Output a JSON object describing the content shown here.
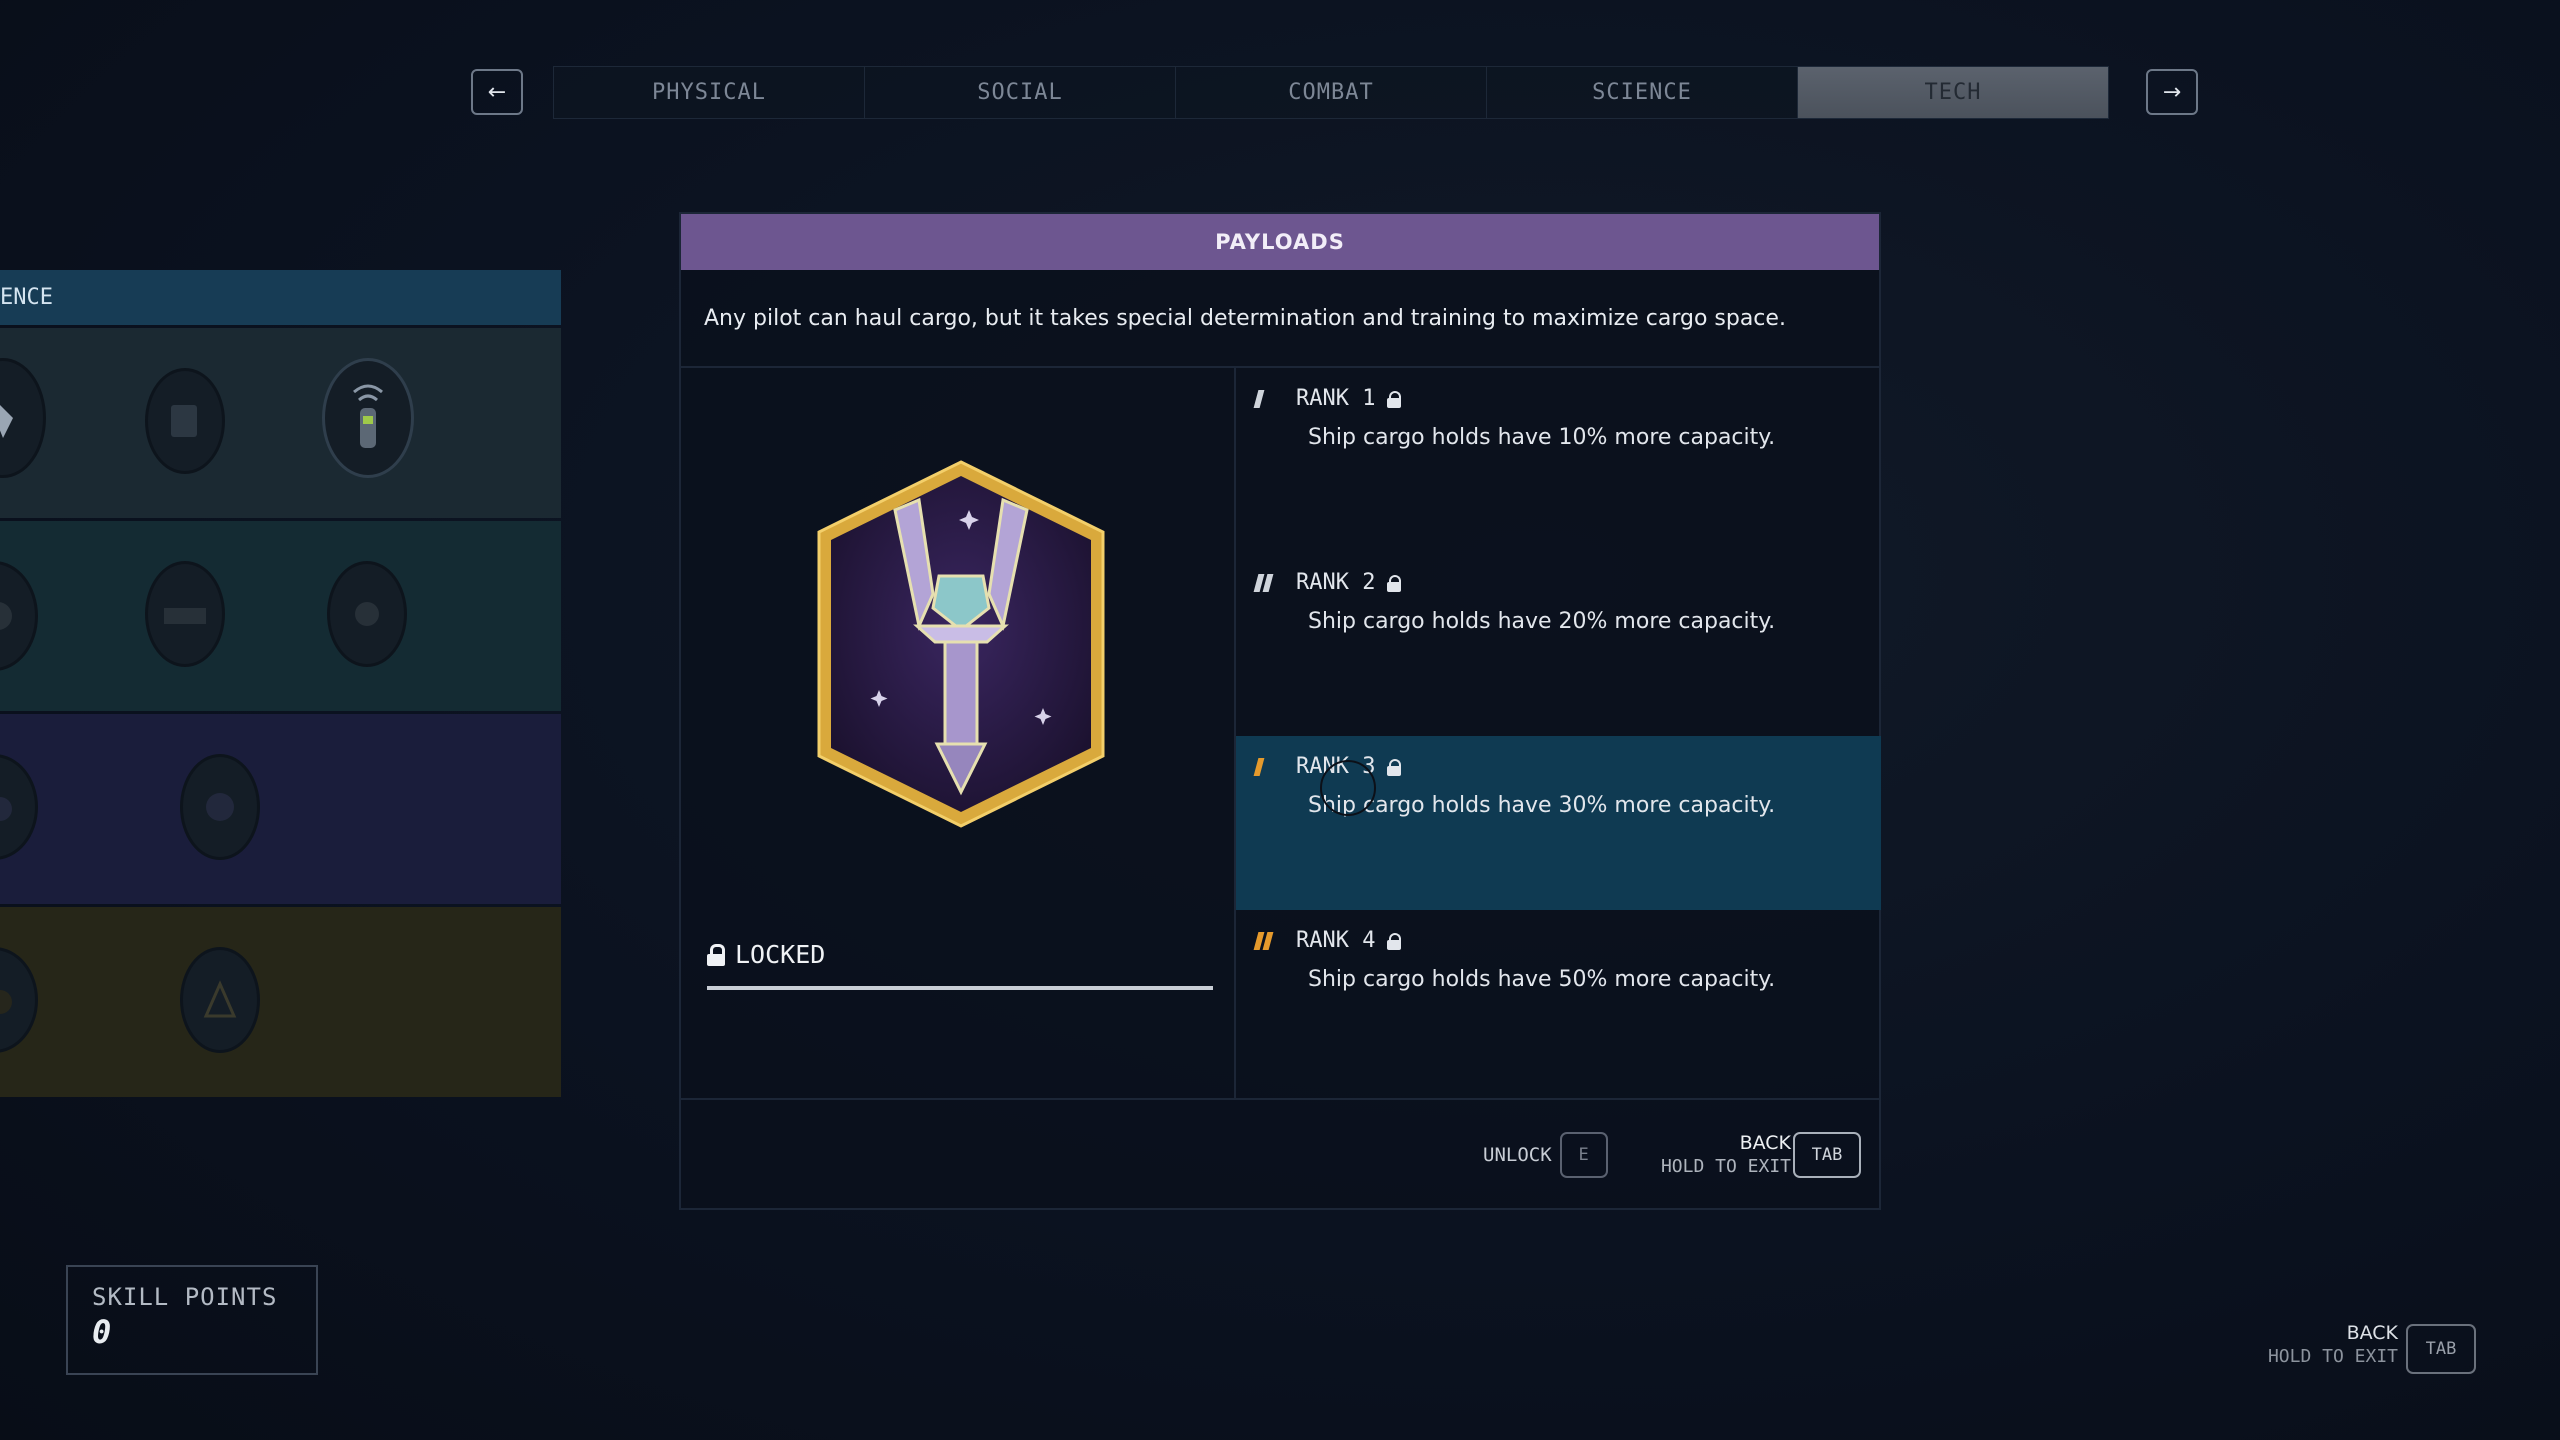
{
  "nav": {
    "prev_icon": "←",
    "next_icon": "→",
    "tabs": [
      {
        "label": "PHYSICAL",
        "active": false
      },
      {
        "label": "SOCIAL",
        "active": false
      },
      {
        "label": "COMBAT",
        "active": false
      },
      {
        "label": "SCIENCE",
        "active": false
      },
      {
        "label": "TECH",
        "active": true
      }
    ]
  },
  "tree": {
    "header": "ENCE"
  },
  "skill": {
    "title": "PAYLOADS",
    "description": "Any pilot can haul cargo, but it takes special determination and training to maximize cargo space.",
    "status": "LOCKED",
    "status_progress": 1.0,
    "badge_icon": "payloads-patch",
    "ranks": [
      {
        "label": "RANK 1",
        "text": "Ship cargo holds have 10% more capacity.",
        "pip_color": "#cfd4db",
        "pips": 1
      },
      {
        "label": "RANK 2",
        "text": "Ship cargo holds have 20% more capacity.",
        "pip_color": "#cfd4db",
        "pips": 2
      },
      {
        "label": "RANK 3",
        "text": "Ship cargo holds have 30% more capacity.",
        "pip_color": "#e59a2c",
        "pips": 1
      },
      {
        "label": "RANK 4",
        "text": "Ship cargo holds have 50% more capacity.",
        "pip_color": "#e59a2c",
        "pips": 2
      }
    ]
  },
  "footer": {
    "unlock_label": "UNLOCK",
    "unlock_key": "E",
    "back_label": "BACK",
    "hold_label": "HOLD TO EXIT",
    "back_key": "TAB"
  },
  "skill_points": {
    "label": "SKILL POINTS",
    "value": "0"
  },
  "corner": {
    "back_label": "BACK",
    "hold_label": "HOLD TO EXIT",
    "back_key": "TAB"
  },
  "colors": {
    "accent_purple": "#6d5690",
    "selected_rank": "#0f3a52",
    "rank_pip_gold": "#e59a2c"
  }
}
